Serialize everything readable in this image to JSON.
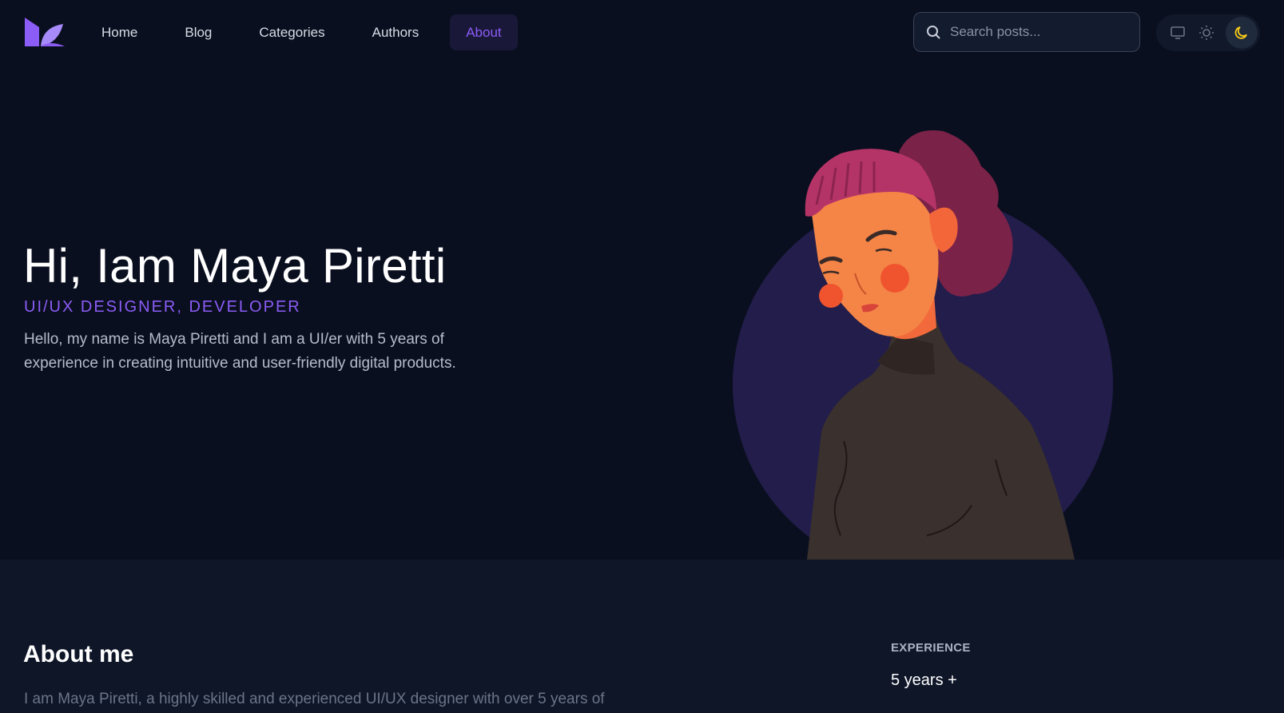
{
  "nav": {
    "items": [
      {
        "label": "Home"
      },
      {
        "label": "Blog"
      },
      {
        "label": "Categories"
      },
      {
        "label": "Authors"
      },
      {
        "label": "About"
      }
    ],
    "active": "About"
  },
  "search": {
    "placeholder": "Search posts..."
  },
  "theme": {
    "options": [
      "system-icon",
      "sun-icon",
      "moon-icon"
    ],
    "active": "moon-icon"
  },
  "hero": {
    "title": "Hi, Iam Maya Piretti",
    "subtitle": "UI/UX DESIGNER, DEVELOPER",
    "description": "Hello, my name is Maya Piretti and I am a UI/er with 5 years of experience in creating intuitive and user-friendly digital products."
  },
  "about": {
    "title": "About me",
    "text": "I am Maya Piretti, a highly skilled and experienced UI/UX designer with over 5 years of",
    "experience_label": "EXPERIENCE",
    "experience_value": "5 years +"
  },
  "colors": {
    "background": "#0a0f1f",
    "section": "#0e1628",
    "accent": "#8b5cf6",
    "moon": "#facc15"
  }
}
